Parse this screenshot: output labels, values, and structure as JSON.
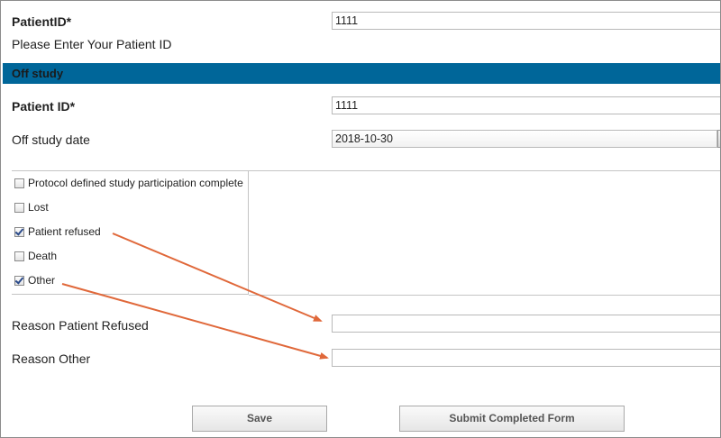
{
  "top": {
    "patient_id_label": "PatientID*",
    "patient_id_value": "1111",
    "patient_id_hint": "Please Enter Your Patient ID"
  },
  "section": {
    "title": "Off study",
    "color": "#006699"
  },
  "off_study": {
    "patient_id_label": "Patient ID*",
    "patient_id_value": "1111",
    "date_label": "Off study date",
    "date_value": "2018-10-30"
  },
  "reasons": [
    {
      "label": "Protocol defined study participation complete",
      "checked": false
    },
    {
      "label": "Lost",
      "checked": false
    },
    {
      "label": "Patient refused",
      "checked": true
    },
    {
      "label": "Death",
      "checked": false
    },
    {
      "label": "Other",
      "checked": true
    }
  ],
  "fields": {
    "reason_refused_label": "Reason Patient Refused",
    "reason_refused_value": "",
    "reason_other_label": "Reason Other",
    "reason_other_value": ""
  },
  "buttons": {
    "save_label": "Save",
    "submit_label": "Submit Completed Form"
  },
  "annotation_color": "#e0683a"
}
